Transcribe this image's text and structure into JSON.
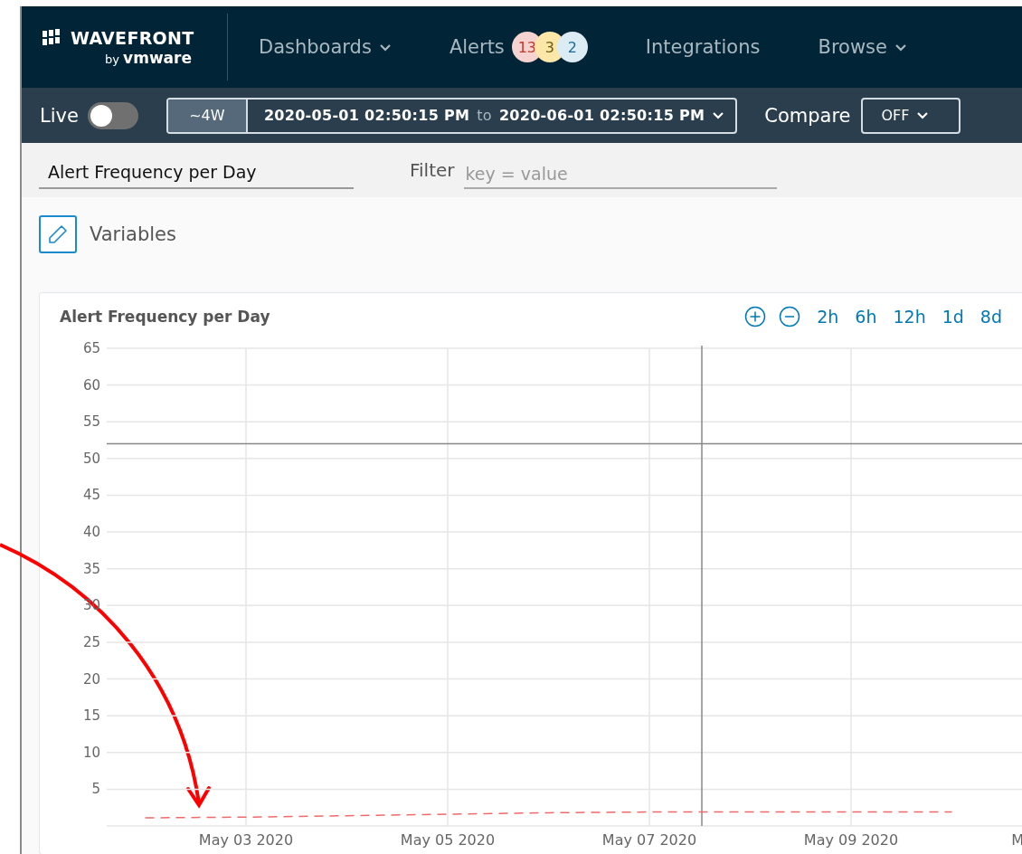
{
  "logo": {
    "name": "WAVEFRONT",
    "by": "by",
    "brand": "vmware"
  },
  "nav": [
    {
      "label": "Dashboards",
      "has_menu": true
    },
    {
      "label": "Alerts",
      "has_menu": false,
      "badges": [
        {
          "text": "13",
          "color": "#f6d3d1"
        },
        {
          "text": "3",
          "color": "#fbe8a8"
        },
        {
          "text": "2",
          "color": "#dcecf4"
        }
      ]
    },
    {
      "label": "Integrations",
      "has_menu": false
    },
    {
      "label": "Browse",
      "has_menu": true
    }
  ],
  "toolbar": {
    "live": {
      "label": "Live",
      "on": false
    },
    "range": {
      "preset": "~4W",
      "from": "2020-05-01 02:50:15 PM",
      "to_word": "to",
      "to": "2020-06-01 02:50:15 PM"
    },
    "compare": {
      "label": "Compare",
      "value": "OFF"
    }
  },
  "filter_bar": {
    "dashboard_name": "Alert Frequency per Day",
    "filter_label": "Filter",
    "filter_placeholder": "key = value"
  },
  "variables": {
    "label": "Variables"
  },
  "chart": {
    "title": "Alert Frequency per Day",
    "zoom_controls": [
      "2h",
      "6h",
      "12h",
      "1d",
      "8d"
    ],
    "edge_label": "M",
    "chart_data": {
      "type": "line",
      "grid": true,
      "ylim": [
        0,
        65
      ],
      "yticks": [
        5,
        10,
        15,
        20,
        25,
        30,
        35,
        40,
        45,
        50,
        55,
        60,
        65
      ],
      "categories": [
        null,
        "May 03 2020",
        null,
        "May 05 2020",
        null,
        "May 07 2020",
        null,
        "May 09 2020",
        null
      ],
      "series": [
        {
          "color": "#f06a6a",
          "line_style": "dashed",
          "values": [
            1.1,
            1.2,
            1.4,
            1.6,
            1.8,
            1.9,
            1.9,
            1.9,
            1.9
          ]
        }
      ],
      "ref_lines": [
        {
          "axis": "y",
          "value": 52
        }
      ]
    }
  }
}
